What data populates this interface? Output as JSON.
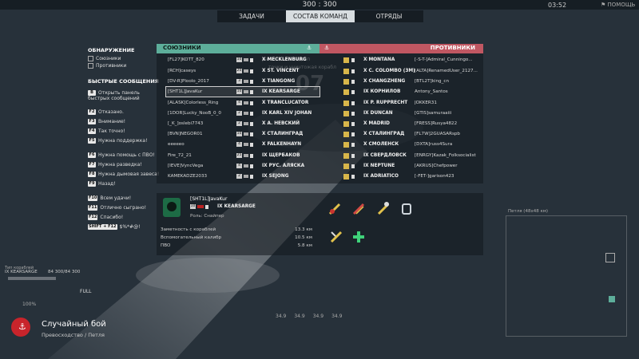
{
  "topbar": {
    "score": "300 : 300",
    "clock": "03:52",
    "help": "ПОМОЩЬ"
  },
  "tabs": [
    {
      "label": "ЗАДАЧИ"
    },
    {
      "label": "СОСТАВ КОМАНД"
    },
    {
      "label": "ОТРЯДЫ"
    }
  ],
  "left_panel": {
    "detection_title": "ОБНАРУЖЕНИЕ",
    "allies_label": "Союзники",
    "enemies_label": "Противники",
    "quick_title": "БЫСТРЫЕ СООБЩЕНИЯ",
    "messages": [
      {
        "key": "B",
        "text": "Открыть панель быстрых сообщений"
      },
      {
        "key": "F2",
        "text": "Отказано."
      },
      {
        "key": "F3",
        "text": "Внимание!"
      },
      {
        "key": "F4",
        "text": "Так точно!"
      },
      {
        "key": "F5",
        "text": "Нужна поддержка!"
      },
      {
        "key": "F6",
        "text": "Нужна помощь с ПВО!"
      },
      {
        "key": "F7",
        "text": "Нужна разведка!"
      },
      {
        "key": "F8",
        "text": "Нужна дымовая завеса!"
      },
      {
        "key": "F9",
        "text": "Назад!"
      },
      {
        "key": "F10",
        "text": "Всем удачи!"
      },
      {
        "key": "F11",
        "text": "Отлично сыграно!"
      },
      {
        "key": "F12",
        "text": "Спасибо!"
      },
      {
        "key": "SHIFT + F12",
        "text": "$%*#@!"
      }
    ]
  },
  "allies": {
    "title": "СОЮЗНИКИ",
    "rows": [
      {
        "player": "[FL27]KOTT_820",
        "level": "10",
        "ship": "X MECKLENBURG"
      },
      {
        "player": "[RCH]caseys",
        "level": "20",
        "ship": "X ST. VINCENT"
      },
      {
        "player": "[DV-R]Ploolo_2017",
        "level": "3",
        "ship": "X TIANGONG"
      },
      {
        "player": "[SHT1L]JavaKur",
        "level": "10",
        "ship": "IX KEARSARGE"
      },
      {
        "player": "[ALASK]Colorless_Ring",
        "level": "4",
        "ship": "X TRANCLUCATOR"
      },
      {
        "player": "[1DOR]Lucky_NooB_0_0",
        "level": "2",
        "ship": "IX KARL XIV JOHAN"
      },
      {
        "player": "[_K_]oslebi7743",
        "level": "2",
        "ship": "X А. НЕВСКИЙ"
      },
      {
        "player": "[BVN]NEGOR01",
        "level": "10",
        "ship": "X СТАЛИНГРАД"
      },
      {
        "player": "eeeeeo",
        "level": "4",
        "ship": "X FALKENHAYN"
      },
      {
        "player": "Fire_72_21",
        "level": "25",
        "ship": "IX ЩЕРБАКОВ"
      },
      {
        "player": "[IEVE]VyncVega",
        "level": "4",
        "ship": "IX РУС. АЛЯСКА"
      },
      {
        "player": "KAMEKADZE2033",
        "level": "2",
        "ship": "IX SEJONG"
      }
    ]
  },
  "enemies": {
    "title": "ПРОТИВНИКИ",
    "rows": [
      {
        "ship": "X MONTANA",
        "player": "[-S-T-]Admiral_Cunningo..."
      },
      {
        "ship": "X C. COLOMBO (3M)",
        "player": "[ALTA]RenamedUser_2127..."
      },
      {
        "ship": "X CHANGZHENG",
        "player": "[BTL2T]king_cn"
      },
      {
        "ship": "IX КОРНИЛОВ",
        "player": "Antony_Santos"
      },
      {
        "ship": "IX P. RUPPRECHT",
        "player": "JOKKER31"
      },
      {
        "ship": "IX DUNCAN",
        "player": "[GTIS]samuraaiii"
      },
      {
        "ship": "X MADRID",
        "player": "[FRESS]Rusya4822"
      },
      {
        "ship": "X СТАЛИНГРАД",
        "player": "[FL7W]2GUASARspb"
      },
      {
        "ship": "X СМОЛЕНСК",
        "player": "[DXTA]russ4Sura"
      },
      {
        "ship": "IX СВЕРДЛОВСК",
        "player": "[ENRGY]Kazak_Folksocialist"
      },
      {
        "ship": "IX NEPTUNE",
        "player": "[AKRUS]Chefpower"
      },
      {
        "ship": "IX ADRIATICO",
        "player": "[-FET-]garison423"
      }
    ]
  },
  "background_text": {
    "line1": "раньше команды п",
    "line1b": "тывая",
    "line2": "точки и уничтожая корабл",
    "number": "07"
  },
  "detail": {
    "player": "[SHT1L]JavaKur",
    "level": "10",
    "ship": "IX KEARSARGE",
    "role": "Роль: Снайпер",
    "stats": [
      {
        "label": "Заметность с кораблей",
        "value": "13.3 км"
      },
      {
        "label": "Вспомогательный калибр",
        "value": "10.5 км"
      },
      {
        "label": "ПВО",
        "value": "5.8 км"
      }
    ]
  },
  "minimap": {
    "label": "Петля (48x48 км)"
  },
  "hud": {
    "ship_name": "IX KEARSARGE",
    "hp": "84 300/84 300",
    "speed": "FULL",
    "zoom": "100%",
    "left_label": "Тип кораблей"
  },
  "ammo": [
    "34.9",
    "34.9",
    "34.9",
    "34.9"
  ],
  "mode": {
    "title": "Случайный бой",
    "subtitle": "Превосходство / Петля"
  },
  "colors": {
    "ally": "#5dae9a",
    "enemy": "#c05762",
    "mode_badge": "#c8242b"
  }
}
